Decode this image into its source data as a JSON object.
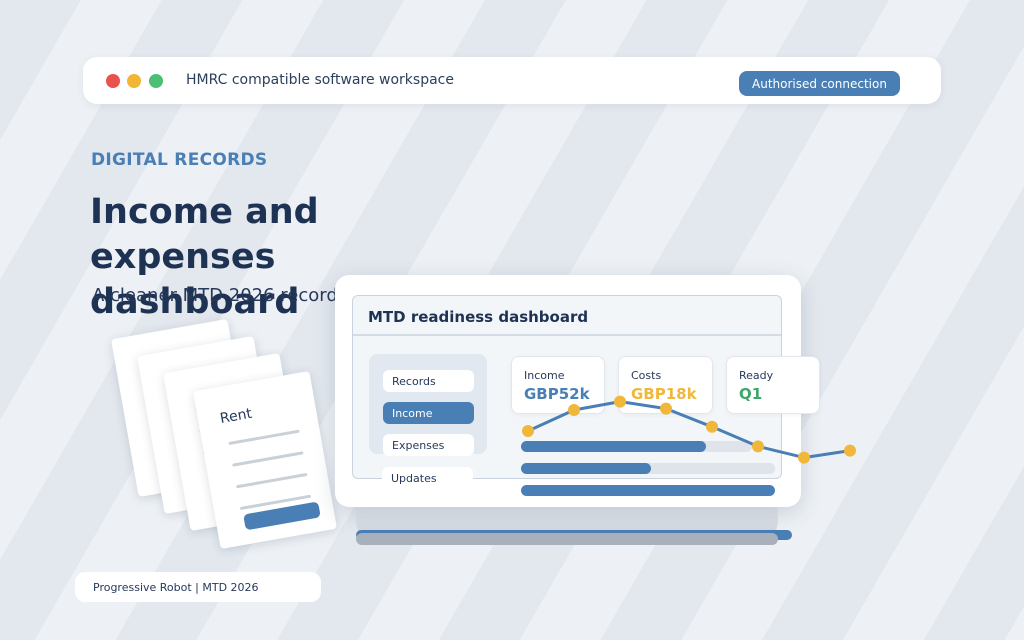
{
  "colors": {
    "brand_blue": "#4a7fb5",
    "accent_yellow": "#f0b73a",
    "accent_green": "#3aa86a",
    "dot_red": "#e9534b",
    "dot_yellow": "#f2b634",
    "dot_green": "#4bbf73"
  },
  "topbar": {
    "title": "HMRC compatible software workspace",
    "connection_label": "Authorised connection"
  },
  "hero": {
    "eyebrow": "DIGITAL RECORDS",
    "headline_line1": "Income and expenses",
    "headline_line2": "dashboard",
    "subhead": "A cleaner MTD 2026 record"
  },
  "documents": {
    "front_title": "Rent"
  },
  "dashboard": {
    "title": "MTD readiness dashboard",
    "nav": [
      {
        "label": "Records",
        "active": false
      },
      {
        "label": "Income",
        "active": true
      },
      {
        "label": "Expenses",
        "active": false
      },
      {
        "label": "Updates",
        "active": false
      }
    ],
    "kpis": [
      {
        "label": "Income",
        "value": "GBP52k",
        "color": "#4a7fb5"
      },
      {
        "label": "Costs",
        "value": "GBP18k",
        "color": "#f0b73a"
      },
      {
        "label": "Ready",
        "value": "Q1",
        "color": "#3aa86a"
      }
    ],
    "progress": [
      0.8,
      0.51,
      1.0
    ],
    "trend": [
      15,
      30,
      36,
      31,
      18,
      4,
      -4,
      1
    ]
  },
  "footer": {
    "text": "Progressive Robot | MTD 2026"
  }
}
